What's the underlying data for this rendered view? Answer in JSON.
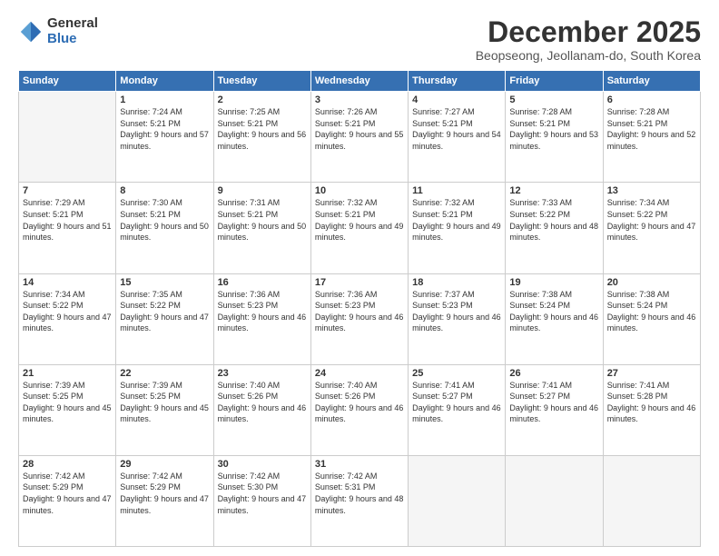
{
  "logo": {
    "general": "General",
    "blue": "Blue"
  },
  "header": {
    "month": "December 2025",
    "location": "Beopseong, Jeollanam-do, South Korea"
  },
  "weekdays": [
    "Sunday",
    "Monday",
    "Tuesday",
    "Wednesday",
    "Thursday",
    "Friday",
    "Saturday"
  ],
  "weeks": [
    [
      {
        "day": "",
        "empty": true
      },
      {
        "day": "1",
        "sunrise": "7:24 AM",
        "sunset": "5:21 PM",
        "daylight": "9 hours and 57 minutes."
      },
      {
        "day": "2",
        "sunrise": "7:25 AM",
        "sunset": "5:21 PM",
        "daylight": "9 hours and 56 minutes."
      },
      {
        "day": "3",
        "sunrise": "7:26 AM",
        "sunset": "5:21 PM",
        "daylight": "9 hours and 55 minutes."
      },
      {
        "day": "4",
        "sunrise": "7:27 AM",
        "sunset": "5:21 PM",
        "daylight": "9 hours and 54 minutes."
      },
      {
        "day": "5",
        "sunrise": "7:28 AM",
        "sunset": "5:21 PM",
        "daylight": "9 hours and 53 minutes."
      },
      {
        "day": "6",
        "sunrise": "7:28 AM",
        "sunset": "5:21 PM",
        "daylight": "9 hours and 52 minutes."
      }
    ],
    [
      {
        "day": "7",
        "sunrise": "7:29 AM",
        "sunset": "5:21 PM",
        "daylight": "9 hours and 51 minutes."
      },
      {
        "day": "8",
        "sunrise": "7:30 AM",
        "sunset": "5:21 PM",
        "daylight": "9 hours and 50 minutes."
      },
      {
        "day": "9",
        "sunrise": "7:31 AM",
        "sunset": "5:21 PM",
        "daylight": "9 hours and 50 minutes."
      },
      {
        "day": "10",
        "sunrise": "7:32 AM",
        "sunset": "5:21 PM",
        "daylight": "9 hours and 49 minutes."
      },
      {
        "day": "11",
        "sunrise": "7:32 AM",
        "sunset": "5:21 PM",
        "daylight": "9 hours and 49 minutes."
      },
      {
        "day": "12",
        "sunrise": "7:33 AM",
        "sunset": "5:22 PM",
        "daylight": "9 hours and 48 minutes."
      },
      {
        "day": "13",
        "sunrise": "7:34 AM",
        "sunset": "5:22 PM",
        "daylight": "9 hours and 47 minutes."
      }
    ],
    [
      {
        "day": "14",
        "sunrise": "7:34 AM",
        "sunset": "5:22 PM",
        "daylight": "9 hours and 47 minutes."
      },
      {
        "day": "15",
        "sunrise": "7:35 AM",
        "sunset": "5:22 PM",
        "daylight": "9 hours and 47 minutes."
      },
      {
        "day": "16",
        "sunrise": "7:36 AM",
        "sunset": "5:23 PM",
        "daylight": "9 hours and 46 minutes."
      },
      {
        "day": "17",
        "sunrise": "7:36 AM",
        "sunset": "5:23 PM",
        "daylight": "9 hours and 46 minutes."
      },
      {
        "day": "18",
        "sunrise": "7:37 AM",
        "sunset": "5:23 PM",
        "daylight": "9 hours and 46 minutes."
      },
      {
        "day": "19",
        "sunrise": "7:38 AM",
        "sunset": "5:24 PM",
        "daylight": "9 hours and 46 minutes."
      },
      {
        "day": "20",
        "sunrise": "7:38 AM",
        "sunset": "5:24 PM",
        "daylight": "9 hours and 46 minutes."
      }
    ],
    [
      {
        "day": "21",
        "sunrise": "7:39 AM",
        "sunset": "5:25 PM",
        "daylight": "9 hours and 45 minutes."
      },
      {
        "day": "22",
        "sunrise": "7:39 AM",
        "sunset": "5:25 PM",
        "daylight": "9 hours and 45 minutes."
      },
      {
        "day": "23",
        "sunrise": "7:40 AM",
        "sunset": "5:26 PM",
        "daylight": "9 hours and 46 minutes."
      },
      {
        "day": "24",
        "sunrise": "7:40 AM",
        "sunset": "5:26 PM",
        "daylight": "9 hours and 46 minutes."
      },
      {
        "day": "25",
        "sunrise": "7:41 AM",
        "sunset": "5:27 PM",
        "daylight": "9 hours and 46 minutes."
      },
      {
        "day": "26",
        "sunrise": "7:41 AM",
        "sunset": "5:27 PM",
        "daylight": "9 hours and 46 minutes."
      },
      {
        "day": "27",
        "sunrise": "7:41 AM",
        "sunset": "5:28 PM",
        "daylight": "9 hours and 46 minutes."
      }
    ],
    [
      {
        "day": "28",
        "sunrise": "7:42 AM",
        "sunset": "5:29 PM",
        "daylight": "9 hours and 47 minutes."
      },
      {
        "day": "29",
        "sunrise": "7:42 AM",
        "sunset": "5:29 PM",
        "daylight": "9 hours and 47 minutes."
      },
      {
        "day": "30",
        "sunrise": "7:42 AM",
        "sunset": "5:30 PM",
        "daylight": "9 hours and 47 minutes."
      },
      {
        "day": "31",
        "sunrise": "7:42 AM",
        "sunset": "5:31 PM",
        "daylight": "9 hours and 48 minutes."
      },
      {
        "day": "",
        "empty": true
      },
      {
        "day": "",
        "empty": true
      },
      {
        "day": "",
        "empty": true
      }
    ]
  ],
  "labels": {
    "sunrise": "Sunrise:",
    "sunset": "Sunset:",
    "daylight": "Daylight hours"
  }
}
